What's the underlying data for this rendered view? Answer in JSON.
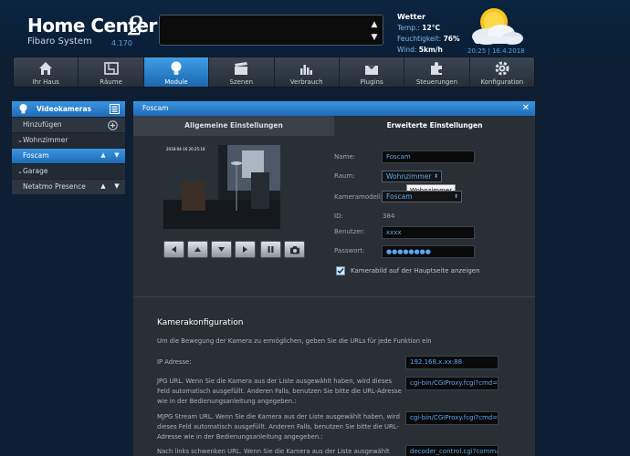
{
  "app": {
    "title": "Home Center",
    "title_number": "2",
    "subtitle": "Fibaro System",
    "version": "4.170"
  },
  "weather": {
    "heading": "Wetter",
    "temp_label": "Temp.:",
    "temp_value": "12°C",
    "humidity_label": "Feuchtigkeit:",
    "humidity_value": "76%",
    "wind_label": "Wind:",
    "wind_value": "5km/h",
    "datetime": "20:25 | 16.4.2018",
    "icon": "sun-cloud-icon"
  },
  "nav": {
    "items": [
      {
        "label": "Ihr Haus",
        "icon": "house-icon"
      },
      {
        "label": "Räume",
        "icon": "rooms-icon"
      },
      {
        "label": "Module",
        "icon": "bulb-icon",
        "active": true
      },
      {
        "label": "Szenen",
        "icon": "clapper-icon"
      },
      {
        "label": "Verbrauch",
        "icon": "chart-icon"
      },
      {
        "label": "Plugins",
        "icon": "plugin-box-icon"
      },
      {
        "label": "Steuerungen",
        "icon": "puzzle-icon"
      },
      {
        "label": "Konfiguration",
        "icon": "gear-icon"
      }
    ]
  },
  "sidebar": {
    "title": "Videokameras",
    "add_label": "Hinzufügen",
    "groups": [
      {
        "name": "Wohnzimmer",
        "items": [
          "Foscam"
        ]
      },
      {
        "name": "Garage",
        "items": [
          "Netatmo Presence"
        ]
      }
    ]
  },
  "panel": {
    "title": "Foscam",
    "tabs": [
      "Allgemeine Einstellungen",
      "Erweiterte Einstellungen"
    ],
    "camera_timestamp": "2018-04-16 20:25:18",
    "fields": {
      "name_label": "Name:",
      "name_value": "Foscam",
      "room_label": "Raum:",
      "room_value": "Wohnzimmer",
      "room_tooltip": "Wohnzimmer",
      "model_label": "Kameramodell:",
      "model_value": "Foscam",
      "id_label": "ID:",
      "id_value": "384",
      "user_label": "Benutzer:",
      "user_value": "xxxx",
      "password_label": "Passwort:",
      "password_value": "●●●●●●●●",
      "checkbox_label": "Kamerabild auf der Hauptseite anzeigen"
    },
    "config": {
      "title": "Kamerakonfiguration",
      "intro": "Um die Bewegung der Kamera zu ermöglichen, geben Sie die URLs für jede Funktion ein",
      "ip_label": "IP Adresse:",
      "ip_value": "192.168.x.xx:88",
      "jpg_label": "JPG URL. Wenn Sie die Kamera aus der Liste ausgewählt haben, wird dieses Feld automatisch ausgefüllt. Anderen Falls, benutzen Sie bitte die URL-Adresse wie in der Bedienungsanleitung angegeben.:",
      "jpg_value": "cgi-bin/CGIProxy.fcgi?cmd=",
      "mjpg_label": "MJPG Stream URL. Wenn Sie die Kamera aus der Liste ausgewählt haben, wird dieses Feld automatisch ausgefüllt. Anderen Falls, benutzen Sie bitte die URL-Adresse wie in der Bedienungsanleitung angegeben.:",
      "mjpg_value": "cgi-bin/CGIProxy.fcgi?cmd=",
      "left_label": "Nach links schwenken URL. Wenn Sie die Kamera aus der Liste ausgewählt haben,",
      "left_value": "decoder_control.cgi?comma"
    }
  },
  "colors": {
    "accent": "#2e86d4",
    "background": "#0e1f33",
    "panel": "#2a2f35",
    "input_text": "#59a8f0"
  }
}
